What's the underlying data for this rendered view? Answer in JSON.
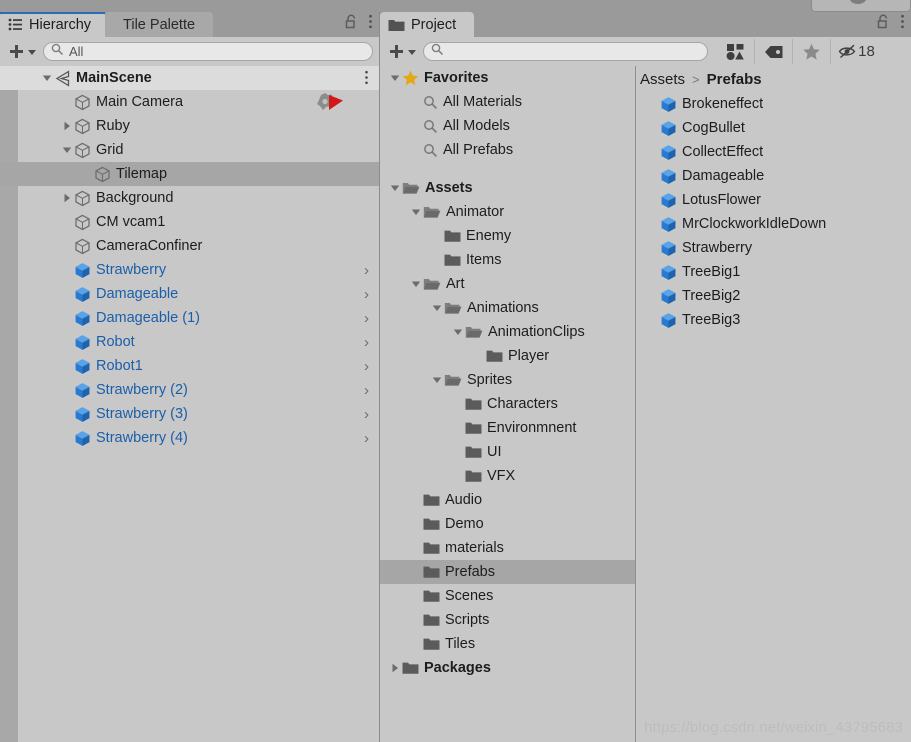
{
  "window": {
    "background_color": "#9a9a9a",
    "panel_color": "#c8c8c8"
  },
  "hierarchy_panel": {
    "tabs": [
      {
        "label": "Hierarchy",
        "icon": "list-icon",
        "active": true
      },
      {
        "label": "Tile Palette",
        "icon": "none",
        "active": false
      }
    ],
    "lock_icon": "padlock-open-icon",
    "menu_icon": "kebab-menu-icon",
    "toolbar": {
      "add_label": "+",
      "add_dropdown_icon": "chevron-down-icon",
      "search": {
        "placeholder": "All",
        "value": "All",
        "icon": "search-icon"
      }
    },
    "items": [
      {
        "label": "MainScene",
        "indent": 1,
        "icon": "unity-scene-icon",
        "expand": "down",
        "bold": true,
        "selected": "light",
        "kebab": true
      },
      {
        "label": "Main Camera",
        "indent": 2,
        "icon": "gameobject-icon",
        "expand": "none",
        "badge": "script-red-flag-icon"
      },
      {
        "label": "Ruby",
        "indent": 2,
        "icon": "gameobject-icon",
        "expand": "right"
      },
      {
        "label": "Grid",
        "indent": 2,
        "icon": "gameobject-icon",
        "expand": "down"
      },
      {
        "label": "Tilemap",
        "indent": 3,
        "icon": "gameobject-icon",
        "expand": "none",
        "selected": "dark"
      },
      {
        "label": "Background",
        "indent": 2,
        "icon": "gameobject-icon",
        "expand": "right"
      },
      {
        "label": "CM vcam1",
        "indent": 2,
        "icon": "gameobject-icon",
        "expand": "none"
      },
      {
        "label": "CameraConfiner",
        "indent": 2,
        "icon": "gameobject-icon",
        "expand": "none"
      },
      {
        "label": "Strawberry",
        "indent": 2,
        "icon": "prefab-icon",
        "expand": "none",
        "prefab": true,
        "arrow": ">"
      },
      {
        "label": "Damageable",
        "indent": 2,
        "icon": "prefab-icon",
        "expand": "none",
        "prefab": true,
        "arrow": ">"
      },
      {
        "label": "Damageable (1)",
        "indent": 2,
        "icon": "prefab-icon",
        "expand": "none",
        "prefab": true,
        "arrow": ">"
      },
      {
        "label": "Robot",
        "indent": 2,
        "icon": "prefab-icon",
        "expand": "none",
        "prefab": true,
        "arrow": ">"
      },
      {
        "label": "Robot1",
        "indent": 2,
        "icon": "prefab-icon",
        "expand": "none",
        "prefab": true,
        "arrow": ">"
      },
      {
        "label": "Strawberry (2)",
        "indent": 2,
        "icon": "prefab-icon",
        "expand": "none",
        "prefab": true,
        "arrow": ">"
      },
      {
        "label": "Strawberry (3)",
        "indent": 2,
        "icon": "prefab-icon",
        "expand": "none",
        "prefab": true,
        "arrow": ">"
      },
      {
        "label": "Strawberry (4)",
        "indent": 2,
        "icon": "prefab-icon",
        "expand": "none",
        "prefab": true,
        "arrow": ">"
      }
    ]
  },
  "project_panel": {
    "tabs": [
      {
        "label": "Project",
        "icon": "folder-icon",
        "active": true
      }
    ],
    "lock_icon": "padlock-open-icon",
    "menu_icon": "kebab-menu-icon",
    "toolbar": {
      "add_label": "+",
      "add_dropdown_icon": "chevron-down-icon",
      "search": {
        "placeholder": "",
        "value": "",
        "icon": "search-icon"
      },
      "buttons": [
        {
          "name": "filter-by-type-icon",
          "label": ""
        },
        {
          "name": "filter-by-label-icon",
          "label": ""
        },
        {
          "name": "favorite-star-icon",
          "label": ""
        }
      ],
      "hidden_count": {
        "icon": "eye-off-icon",
        "value": "18"
      }
    },
    "tree": [
      {
        "label": "Favorites",
        "indent": 0,
        "icon": "star-icon",
        "expand": "down",
        "bold": true
      },
      {
        "label": "All Materials",
        "indent": 1,
        "icon": "search-icon",
        "expand": "none"
      },
      {
        "label": "All Models",
        "indent": 1,
        "icon": "search-icon",
        "expand": "none"
      },
      {
        "label": "All Prefabs",
        "indent": 1,
        "icon": "search-icon",
        "expand": "none"
      },
      {
        "label": "",
        "indent": 0,
        "icon": "none",
        "expand": "none",
        "spacer": true
      },
      {
        "label": "Assets",
        "indent": 0,
        "icon": "folder-open-icon",
        "expand": "down",
        "bold": true
      },
      {
        "label": "Animator",
        "indent": 1,
        "icon": "folder-open-icon",
        "expand": "down"
      },
      {
        "label": "Enemy",
        "indent": 2,
        "icon": "folder-icon",
        "expand": "none"
      },
      {
        "label": "Items",
        "indent": 2,
        "icon": "folder-icon",
        "expand": "none"
      },
      {
        "label": "Art",
        "indent": 1,
        "icon": "folder-open-icon",
        "expand": "down"
      },
      {
        "label": "Animations",
        "indent": 2,
        "icon": "folder-open-icon",
        "expand": "down"
      },
      {
        "label": "AnimationClips",
        "indent": 3,
        "icon": "folder-open-icon",
        "expand": "down"
      },
      {
        "label": "Player",
        "indent": 4,
        "icon": "folder-icon",
        "expand": "none"
      },
      {
        "label": "Sprites",
        "indent": 2,
        "icon": "folder-open-icon",
        "expand": "down"
      },
      {
        "label": "Characters",
        "indent": 3,
        "icon": "folder-icon",
        "expand": "none"
      },
      {
        "label": "Environmnent",
        "indent": 3,
        "icon": "folder-icon",
        "expand": "none"
      },
      {
        "label": "UI",
        "indent": 3,
        "icon": "folder-icon",
        "expand": "none"
      },
      {
        "label": "VFX",
        "indent": 3,
        "icon": "folder-icon",
        "expand": "none"
      },
      {
        "label": "Audio",
        "indent": 1,
        "icon": "folder-icon",
        "expand": "none"
      },
      {
        "label": "Demo",
        "indent": 1,
        "icon": "folder-icon",
        "expand": "none"
      },
      {
        "label": "materials",
        "indent": 1,
        "icon": "folder-icon",
        "expand": "none"
      },
      {
        "label": "Prefabs",
        "indent": 1,
        "icon": "folder-icon",
        "expand": "none",
        "selected": "dark"
      },
      {
        "label": "Scenes",
        "indent": 1,
        "icon": "folder-icon",
        "expand": "none"
      },
      {
        "label": "Scripts",
        "indent": 1,
        "icon": "folder-icon",
        "expand": "none"
      },
      {
        "label": "Tiles",
        "indent": 1,
        "icon": "folder-icon",
        "expand": "none"
      },
      {
        "label": "Packages",
        "indent": 0,
        "icon": "folder-icon",
        "expand": "right",
        "bold": true
      }
    ],
    "breadcrumb": {
      "root": "Assets",
      "separator": ">",
      "leaf": "Prefabs"
    },
    "assets": [
      {
        "label": "Brokeneffect",
        "icon": "prefab-icon"
      },
      {
        "label": "CogBullet",
        "icon": "prefab-icon"
      },
      {
        "label": "CollectEffect",
        "icon": "prefab-icon"
      },
      {
        "label": "Damageable",
        "icon": "prefab-icon"
      },
      {
        "label": "LotusFlower",
        "icon": "prefab-icon"
      },
      {
        "label": "MrClockworkIdleDown",
        "icon": "prefab-icon"
      },
      {
        "label": "Strawberry",
        "icon": "prefab-icon"
      },
      {
        "label": "TreeBig1",
        "icon": "prefab-icon"
      },
      {
        "label": "TreeBig2",
        "icon": "prefab-icon"
      },
      {
        "label": "TreeBig3",
        "icon": "prefab-icon"
      }
    ]
  },
  "watermark": {
    "text": "https://blog.csdn.net/weixin_43795683"
  },
  "colors": {
    "prefab_blue": "#2a7ad1",
    "prefab_text": "#1b5faa",
    "star_gold": "#e2a818",
    "accent_tab": "#2b6cb8",
    "selected_dark": "#a6a6a6",
    "selected_light": "#dcdcdc"
  }
}
